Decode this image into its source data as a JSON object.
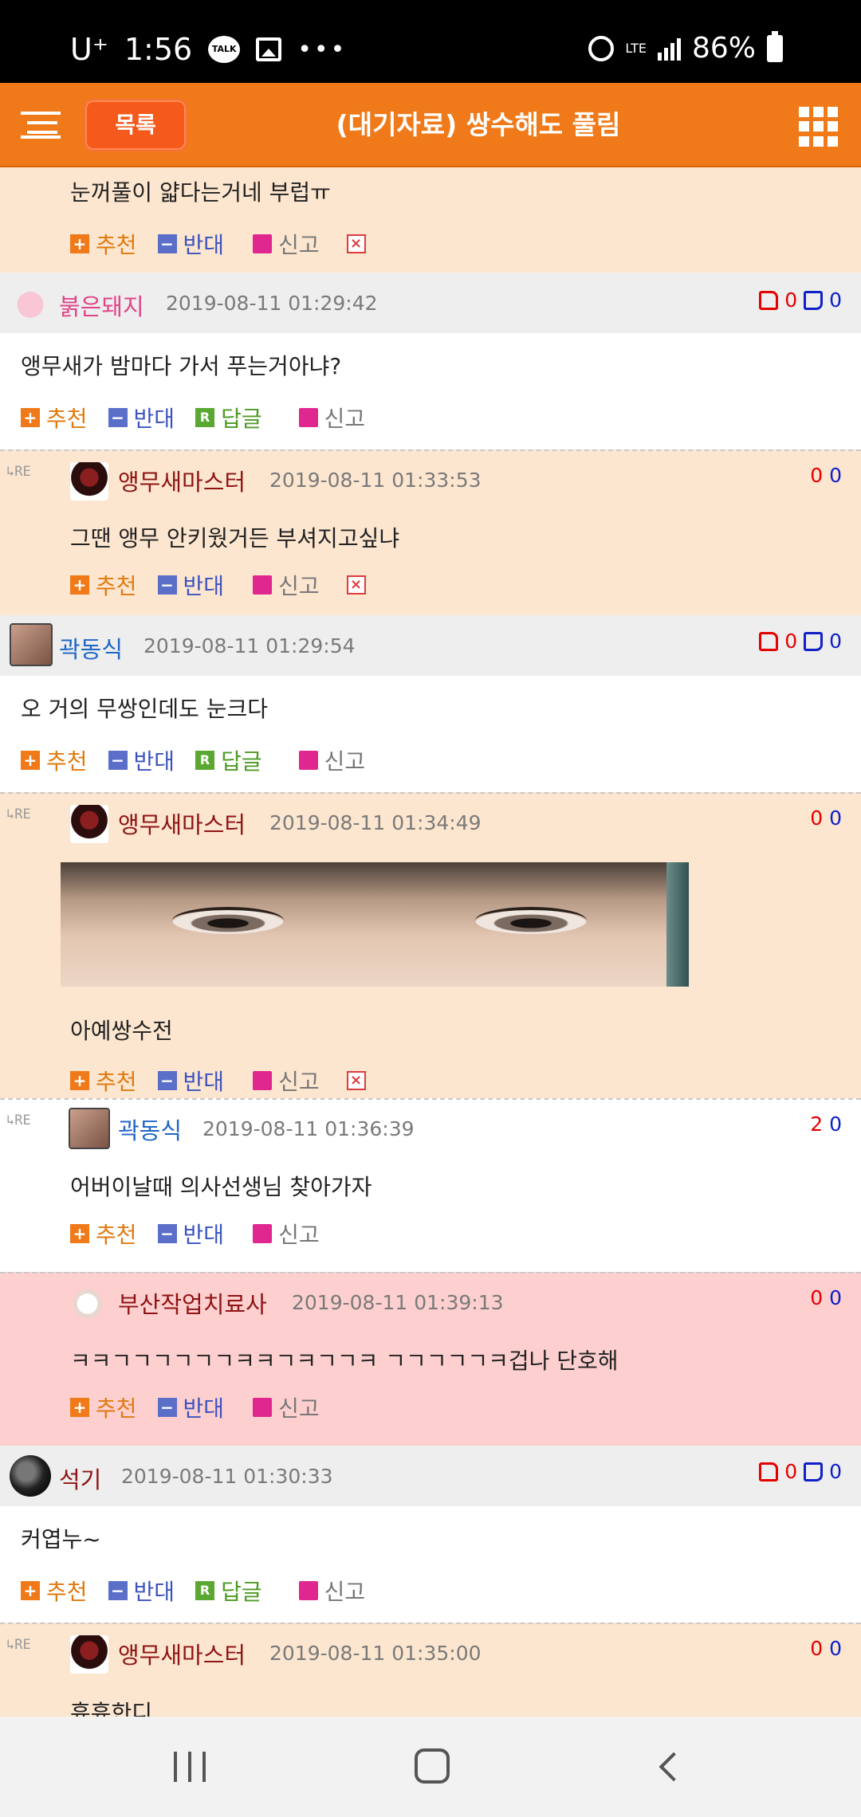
{
  "status_bar": {
    "carrier": "U⁺",
    "time": "1:56",
    "talk": "TALK",
    "network": "LTE",
    "battery": "86%"
  },
  "header": {
    "list_button": "목록",
    "title": "(대기자료) 쌍수해도 풀림"
  },
  "labels": {
    "recommend": "추천",
    "oppose": "반대",
    "reply": "답글",
    "report": "신고",
    "re": "RE",
    "x": "×",
    "plus": "+",
    "minus": "−",
    "r": "R"
  },
  "comments": [
    {
      "text": "눈꺼풀이 얇다는거네 부럽ㅠ"
    },
    {
      "nick": "붉은돼지",
      "date": "2019-08-11 01:29:42",
      "up": "0",
      "down": "0",
      "text": "앵무새가 밤마다 가서 푸는거아냐?"
    },
    {
      "nick": "앵무새마스터",
      "date": "2019-08-11 01:33:53",
      "up": "0",
      "down": "0",
      "text": "그땐 앵무 안키웠거든 부셔지고싶냐"
    },
    {
      "nick": "곽동식",
      "date": "2019-08-11 01:29:54",
      "up": "0",
      "down": "0",
      "text": "오 거의 무쌍인데도 눈크다"
    },
    {
      "nick": "앵무새마스터",
      "date": "2019-08-11 01:34:49",
      "up": "0",
      "down": "0",
      "text": "아예쌍수전"
    },
    {
      "nick": "곽동식",
      "date": "2019-08-11 01:36:39",
      "up": "2",
      "down": "0",
      "text": "어버이날때 의사선생님 찾아가자"
    },
    {
      "nick": "부산작업치료사",
      "date": "2019-08-11 01:39:13",
      "up": "0",
      "down": "0",
      "text": "ㅋㅋㄱㄱㄱㄱㄱㄱㅋㅋㄱㅋㄱㄱㅋ ㄱㄱㄱㄱㄱㅋ겁나 단호해"
    },
    {
      "nick": "석기",
      "date": "2019-08-11 01:30:33",
      "up": "0",
      "down": "0",
      "text": "커엽누~"
    },
    {
      "nick": "앵무새마스터",
      "date": "2019-08-11 01:35:00",
      "up": "0",
      "down": "0",
      "text": "흌흌한디"
    }
  ]
}
